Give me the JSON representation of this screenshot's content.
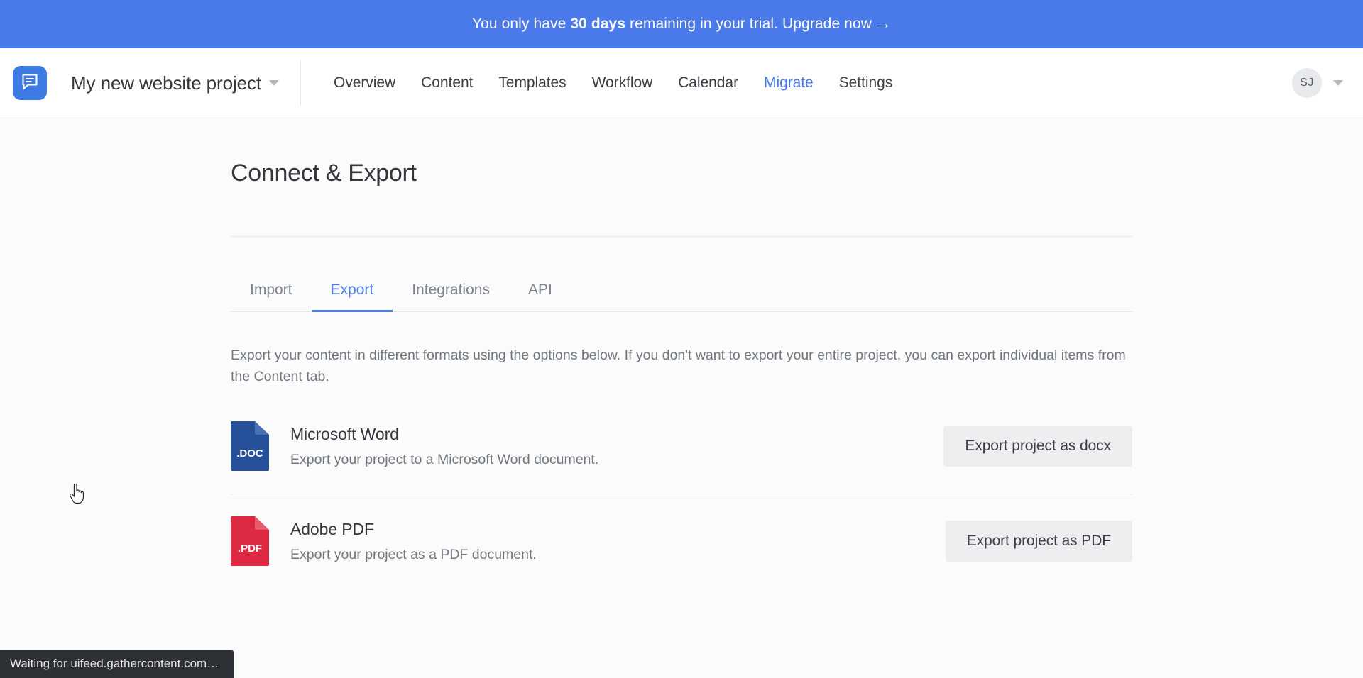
{
  "banner": {
    "prefix": "You only have ",
    "highlight": "30 days",
    "suffix": " remaining in your trial. ",
    "link": "Upgrade now →",
    "background_color": "#4a7aea"
  },
  "header": {
    "logo_icon": "document-bubble-icon",
    "project_name": "My new website project",
    "project_caret_icon": "chevron-down-icon",
    "nav": [
      {
        "label": "Overview",
        "active": false
      },
      {
        "label": "Content",
        "active": false
      },
      {
        "label": "Templates",
        "active": false
      },
      {
        "label": "Workflow",
        "active": false
      },
      {
        "label": "Calendar",
        "active": false
      },
      {
        "label": "Migrate",
        "active": true
      },
      {
        "label": "Settings",
        "active": false
      }
    ],
    "accent_color": "#4a7aea",
    "user": {
      "initials": "SJ",
      "caret_icon": "chevron-down-icon"
    }
  },
  "main": {
    "page_title": "Connect & Export",
    "tabs": [
      {
        "label": "Import",
        "active": false
      },
      {
        "label": "Export",
        "active": true
      },
      {
        "label": "Integrations",
        "active": false
      },
      {
        "label": "API",
        "active": false
      }
    ],
    "description": "Export your content in different formats using the options below. If you don't want to export your entire project, you can export individual items from the Content tab.",
    "export_options": [
      {
        "icon_name": "doc-file-icon",
        "icon_label": ".DOC",
        "icon_color": "#27509b",
        "name": "Microsoft Word",
        "description": "Export your project to a Microsoft Word document.",
        "button_label": "Export project as docx"
      },
      {
        "icon_name": "pdf-file-icon",
        "icon_label": ".PDF",
        "icon_color": "#dd2942",
        "name": "Adobe PDF",
        "description": "Export your project as a PDF document.",
        "button_label": "Export project as PDF"
      }
    ]
  },
  "status_bar": {
    "text": "Waiting for uifeed.gathercontent.com…"
  }
}
